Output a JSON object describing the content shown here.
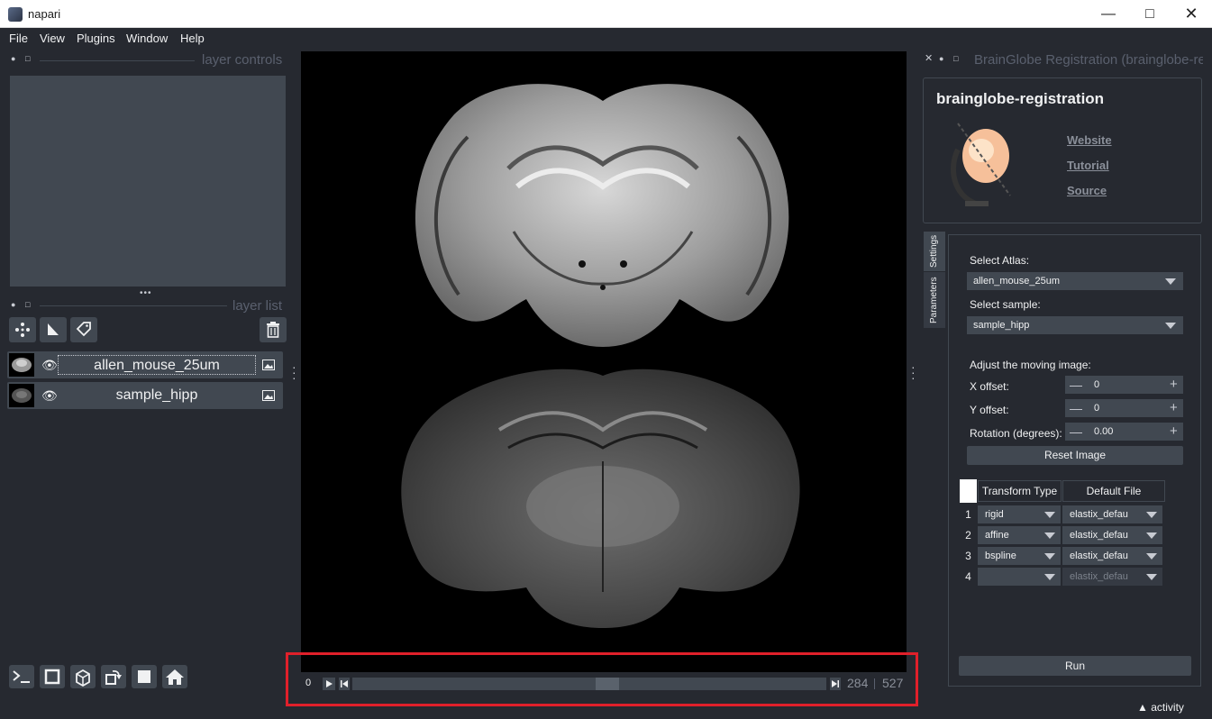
{
  "window": {
    "title": "napari"
  },
  "menu": {
    "file": "File",
    "view": "View",
    "plugins": "Plugins",
    "window": "Window",
    "help": "Help"
  },
  "left": {
    "layer_controls_title": "layer controls",
    "layer_list_title": "layer list",
    "layers": [
      {
        "name": "allen_mouse_25um"
      },
      {
        "name": "sample_hipp"
      }
    ]
  },
  "dims": {
    "start": "0",
    "current": "284",
    "total": "527",
    "slider_position": 0.539
  },
  "plugin": {
    "dock_title": "BrainGlobe Registration (brainglobe-regi",
    "name": "brainglobe-registration",
    "links": {
      "website": "Website",
      "tutorial": "Tutorial",
      "source": "Source"
    },
    "tabs": {
      "settings": "Settings",
      "parameters": "Parameters"
    },
    "select_atlas_label": "Select Atlas:",
    "atlas_value": "allen_mouse_25um",
    "select_sample_label": "Select sample:",
    "sample_value": "sample_hipp",
    "adjust_label": "Adjust the moving image:",
    "x_offset_label": "X offset:",
    "x_offset_value": "0",
    "y_offset_label": "Y offset:",
    "y_offset_value": "0",
    "rotation_label": "Rotation (degrees):",
    "rotation_value": "0.00",
    "reset_button": "Reset Image",
    "table": {
      "headers": [
        "Transform Type",
        "Default File"
      ],
      "rows": [
        {
          "num": "1",
          "type": "rigid",
          "file": "elastix_defau"
        },
        {
          "num": "2",
          "type": "affine",
          "file": "elastix_defau"
        },
        {
          "num": "3",
          "type": "bspline",
          "file": "elastix_defau"
        },
        {
          "num": "4",
          "type": "",
          "file": "elastix_defau"
        }
      ]
    },
    "run_button": "Run"
  },
  "status": {
    "activity": "activity"
  }
}
